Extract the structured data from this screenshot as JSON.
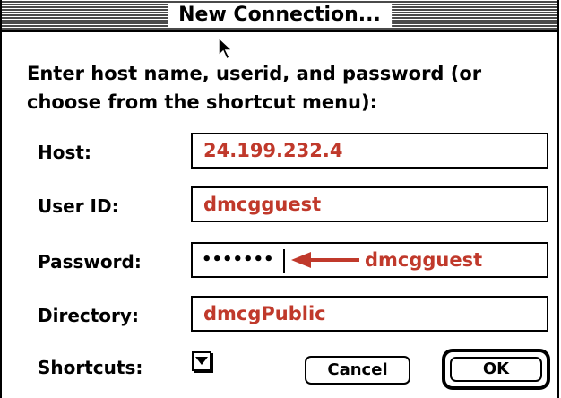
{
  "window": {
    "title": "New Connection..."
  },
  "prompt": {
    "text": "Enter host name, userid, and password (or choose from the shortcut menu):"
  },
  "fields": {
    "host": {
      "label": "Host:",
      "value": "24.199.232.4"
    },
    "user_id": {
      "label": "User ID:",
      "value": "dmcgguest"
    },
    "password": {
      "label": "Password:",
      "masked_value": "•••••••",
      "annotation": "dmcgguest"
    },
    "directory": {
      "label": "Directory:",
      "value": "dmcgPublic"
    }
  },
  "shortcuts": {
    "label": "Shortcuts:"
  },
  "buttons": {
    "cancel_label": "Cancel",
    "ok_label": "OK"
  },
  "colors": {
    "annotation": "#c0392b",
    "title_stripes": "#4a4a4a"
  },
  "icons": {
    "shortcuts_menu": "triangle-down-icon",
    "pointer": "mouse-pointer-icon",
    "annotation_arrow": "left-arrow-icon"
  }
}
